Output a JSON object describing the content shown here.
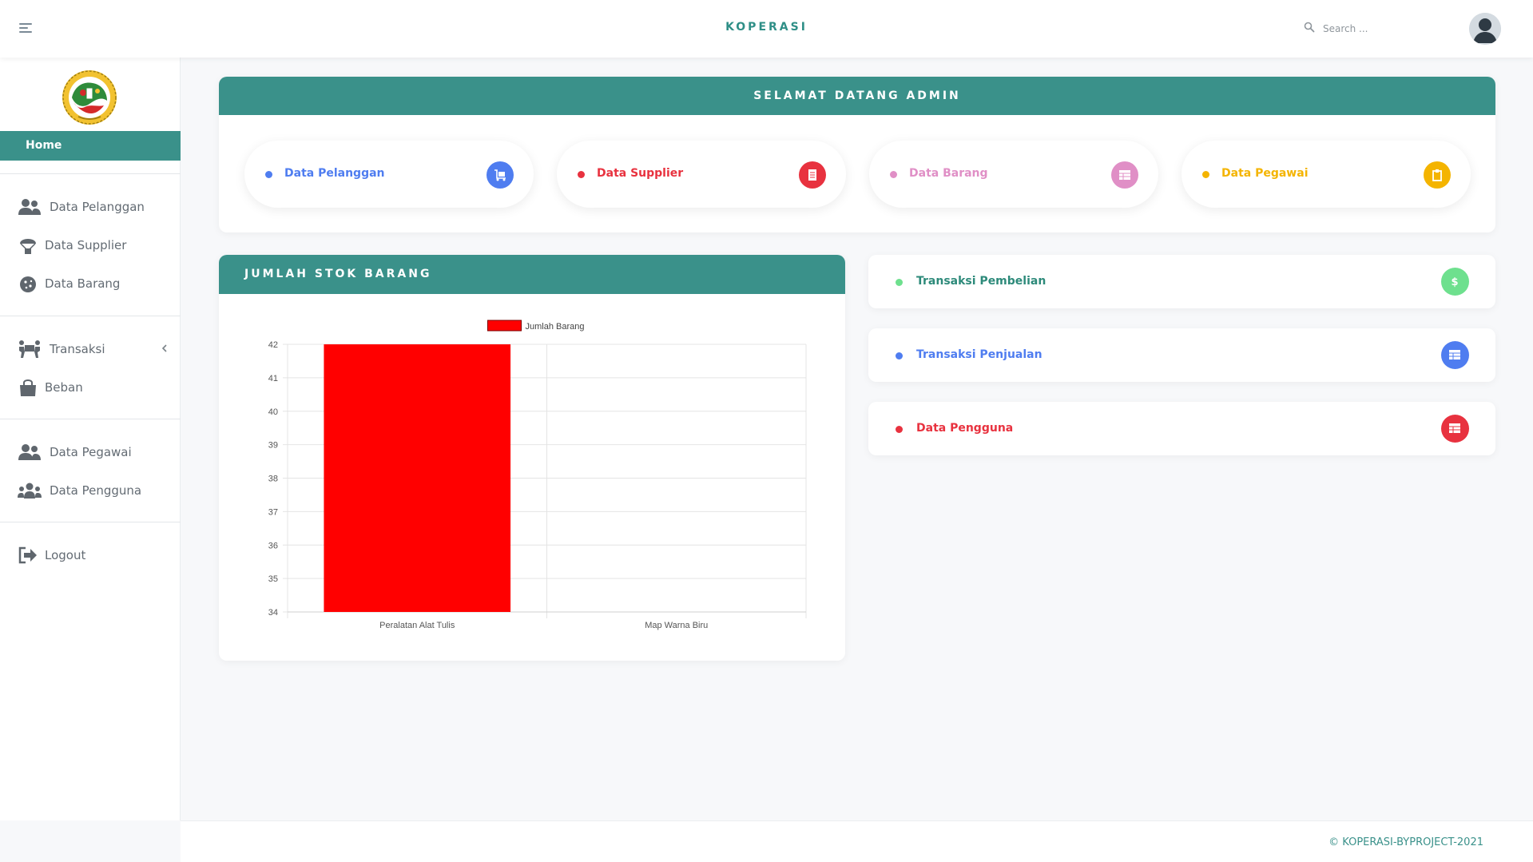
{
  "header": {
    "brand": "KOPERASI",
    "search_placeholder": "Search ...",
    "menu_icon": "hamburger-icon",
    "avatar_icon": "user-avatar"
  },
  "sidebar": {
    "home_label": "Home",
    "groups": [
      [
        {
          "label": "Data Pelanggan",
          "icon": "users-icon"
        },
        {
          "label": "Data Supplier",
          "icon": "parachute-box-icon"
        },
        {
          "label": "Data Barang",
          "icon": "cookie-icon"
        }
      ],
      [
        {
          "label": "Transaksi",
          "icon": "people-carry-icon",
          "has_submenu": true
        },
        {
          "label": "Beban",
          "icon": "shopping-bag-icon"
        }
      ],
      [
        {
          "label": "Data Pegawai",
          "icon": "user-friends-icon"
        },
        {
          "label": "Data Pengguna",
          "icon": "users-group-icon"
        }
      ],
      [
        {
          "label": "Logout",
          "icon": "sign-out-icon"
        }
      ]
    ]
  },
  "welcome": {
    "title": "SELAMAT DATANG ADMIN",
    "cards": [
      {
        "label": "Data Pelanggan",
        "color": "#4f7df0",
        "icon": "dolly-icon"
      },
      {
        "label": "Data Supplier",
        "color": "#e8323f",
        "icon": "receipt-icon"
      },
      {
        "label": "Data Barang",
        "color": "#e08fc6",
        "icon": "table-icon"
      },
      {
        "label": "Data Pegawai",
        "color": "#f4b400",
        "icon": "clipboard-icon"
      }
    ]
  },
  "stock_card": {
    "title": "JUMLAH STOK BARANG"
  },
  "chart_data": {
    "type": "bar",
    "categories": [
      "Peralatan Alat Tulis",
      "Map Warna Biru"
    ],
    "series": [
      {
        "name": "Jumlah Barang",
        "values": [
          42,
          34
        ],
        "color": "#ff0000"
      }
    ],
    "ylim": [
      34,
      42
    ],
    "yticks": [
      34,
      35,
      36,
      37,
      38,
      39,
      40,
      41,
      42
    ],
    "legend_position": "top-center",
    "grid": true
  },
  "side_cards": [
    {
      "label": "Transaksi Pembelian",
      "text_color": "#2d8a7a",
      "color": "#6ee08e",
      "icon": "dollar-icon"
    },
    {
      "label": "Transaksi Penjualan",
      "text_color": "#4f7df0",
      "color": "#4f7df0",
      "icon": "table-icon"
    },
    {
      "label": "Data Pengguna",
      "text_color": "#e8323f",
      "color": "#e8323f",
      "icon": "table-icon"
    }
  ],
  "footer": {
    "copyright": "© KOPERASI-BYPROJECT-2021"
  }
}
